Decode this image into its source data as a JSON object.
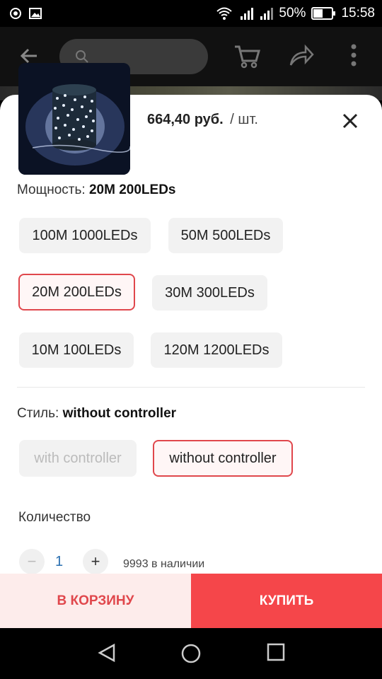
{
  "status_bar": {
    "battery": "50%",
    "time": "15:58",
    "icons": [
      "location-icon",
      "image-icon",
      "wifi-icon",
      "signal-icon",
      "signal-icon",
      "battery-icon"
    ]
  },
  "app_bar": {
    "icons": [
      "back-arrow-icon",
      "search-icon",
      "cart-icon",
      "share-icon",
      "more-vert-icon"
    ]
  },
  "product": {
    "price": "664,40 руб.",
    "unit": "/ шт."
  },
  "power": {
    "label": "Мощность:",
    "selected": "20M 200LEDs",
    "options": [
      "100M 1000LEDs",
      "50M 500LEDs",
      "20M 200LEDs",
      "30M 300LEDs",
      "10M 100LEDs",
      "120M 1200LEDs"
    ]
  },
  "style": {
    "label": "Стиль:",
    "selected": "without controller",
    "options": [
      "with controller",
      "without controller"
    ]
  },
  "quantity": {
    "label": "Количество",
    "minus": "−",
    "value": "1",
    "plus": "+",
    "stock": "9993 в наличии"
  },
  "actions": {
    "add_to_cart": "В КОРЗИНУ",
    "buy": "КУПИТЬ"
  },
  "colors": {
    "accent": "#f5464a",
    "accent_light": "#fdeceb",
    "quantity_value": "#2a6fb0"
  }
}
